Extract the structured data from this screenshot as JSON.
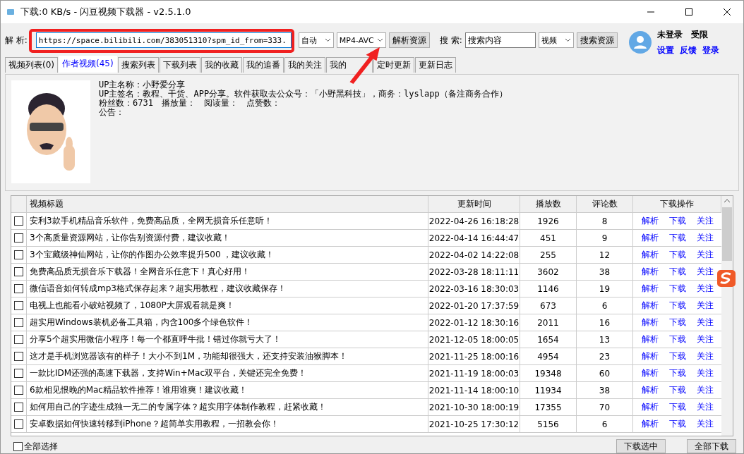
{
  "window": {
    "title": "下载:0 KB/s - 闪豆视频下载器 - v2.5.1.0"
  },
  "parse_bar": {
    "label": "解 析:",
    "url": "https://space.bilibili.com/383051310?spm_id_from=333.",
    "quality": "自动",
    "format": "MP4-AVC",
    "button": "解析资源"
  },
  "search_bar": {
    "label": "搜 索:",
    "value": "搜索内容",
    "type": "视频",
    "button": "搜索资源"
  },
  "account": {
    "status": "未登录",
    "limit": "受限",
    "links": [
      "设置",
      "反馈",
      "登录"
    ]
  },
  "tabs": [
    {
      "label": "视频列表(0)",
      "selected": false
    },
    {
      "label": "作者视频(45)",
      "selected": true
    },
    {
      "label": "搜索列表",
      "selected": false
    },
    {
      "label": "下载列表",
      "selected": false
    },
    {
      "label": "我的收藏",
      "selected": false
    },
    {
      "label": "我的追番",
      "selected": false
    },
    {
      "label": "我的关注",
      "selected": false
    },
    {
      "label": "我的",
      "selected": false,
      "covered": true
    },
    {
      "label": "定时更新",
      "selected": false
    },
    {
      "label": "更新日志",
      "selected": false
    }
  ],
  "uploader": {
    "name_line": "UP主名称：小野爱分享",
    "sign_line": "UP主签名：教程、干货、APP分享。软件获取去公众号：「小野黑科技」，商务：lyslapp（备注商务合作）",
    "stats": [
      "粉丝数：6731",
      "播放量：",
      "阅读量：",
      "点赞数："
    ],
    "notice": "公告："
  },
  "table": {
    "columns": [
      "视频标题",
      "更新时间",
      "播放数",
      "评论数",
      "下载操作"
    ],
    "rows": [
      {
        "checked": false,
        "title": "安利3款手机精品音乐软件，免费高品质，全网无损音乐任意听！",
        "time": "2022-04-26 16:18:28",
        "plays": "1926",
        "comments": "8",
        "actions": [
          "解析",
          "下载",
          "关注"
        ]
      },
      {
        "checked": false,
        "title": "3个高质量资源网站，让你告别资源付费，建议收藏！",
        "time": "2022-04-14 16:44:47",
        "plays": "451",
        "comments": "9",
        "actions": [
          "解析",
          "下载",
          "关注"
        ]
      },
      {
        "checked": false,
        "title": "3个宝藏级神仙网站，让你的作图办公效率提升500 ，建议收藏！",
        "time": "2022-04-02 14:22:08",
        "plays": "255",
        "comments": "12",
        "actions": [
          "解析",
          "下载",
          "关注"
        ]
      },
      {
        "checked": false,
        "title": "免费高品质无损音乐下载器！全网音乐任意下！真心好用！",
        "time": "2022-03-28 18:11:11",
        "plays": "3602",
        "comments": "38",
        "actions": [
          "解析",
          "下载",
          "关注"
        ]
      },
      {
        "checked": false,
        "title": "微信语音如何转成mp3格式保存起来？超实用教程，建议收藏保存！",
        "time": "2022-03-16 18:30:03",
        "plays": "1146",
        "comments": "19",
        "actions": [
          "解析",
          "下载",
          "关注"
        ]
      },
      {
        "checked": false,
        "title": "电视上也能看小破站视频了，1080P大屏观看就是爽！",
        "time": "2022-01-20 17:37:59",
        "plays": "673",
        "comments": "6",
        "actions": [
          "解析",
          "下载",
          "关注"
        ]
      },
      {
        "checked": false,
        "title": "超实用Windows装机必备工具箱，内含100多个绿色软件！",
        "time": "2022-01-12 18:30:16",
        "plays": "2011",
        "comments": "16",
        "actions": [
          "解析",
          "下载",
          "关注"
        ]
      },
      {
        "checked": false,
        "title": "分享5个超实用微信小程序！每一个都直呼牛批！错过你就亏大了！",
        "time": "2021-12-05 18:00:05",
        "plays": "1654",
        "comments": "13",
        "actions": [
          "解析",
          "下载",
          "关注"
        ]
      },
      {
        "checked": false,
        "title": "这才是手机浏览器该有的样子！大小不到1M，功能却很强大，还支持安装油猴脚本！",
        "time": "2021-11-25 18:00:16",
        "plays": "4954",
        "comments": "23",
        "actions": [
          "解析",
          "下载",
          "关注"
        ]
      },
      {
        "checked": false,
        "title": "一款比IDM还强的高速下载器，支持Win+Mac双平台，关键还完全免费！",
        "time": "2021-11-19 18:00:03",
        "plays": "19348",
        "comments": "60",
        "actions": [
          "解析",
          "下载",
          "关注"
        ]
      },
      {
        "checked": false,
        "title": "6款相见恨晚的Mac精品软件推荐！谁用谁爽！建议收藏！",
        "time": "2021-11-14 18:00:10",
        "plays": "11934",
        "comments": "38",
        "actions": [
          "解析",
          "下载",
          "关注"
        ]
      },
      {
        "checked": false,
        "title": "如何用自己的字迹生成独一无二的专属字体？超实用字体制作教程，赶紧收藏！",
        "time": "2021-10-30 18:00:19",
        "plays": "17355",
        "comments": "70",
        "actions": [
          "解析",
          "下载",
          "关注"
        ]
      },
      {
        "checked": false,
        "title": "安卓数据如何快速转移到iPhone？超简单实用教程，一招教会你！",
        "time": "2021-10-25 17:30:12",
        "plays": "5156",
        "comments": "6",
        "actions": [
          "解析",
          "下载",
          "关注"
        ]
      }
    ]
  },
  "footer": {
    "select_all": {
      "label": "全部选择",
      "checked": false
    },
    "buttons": [
      "下载选中",
      "全部下载"
    ]
  }
}
